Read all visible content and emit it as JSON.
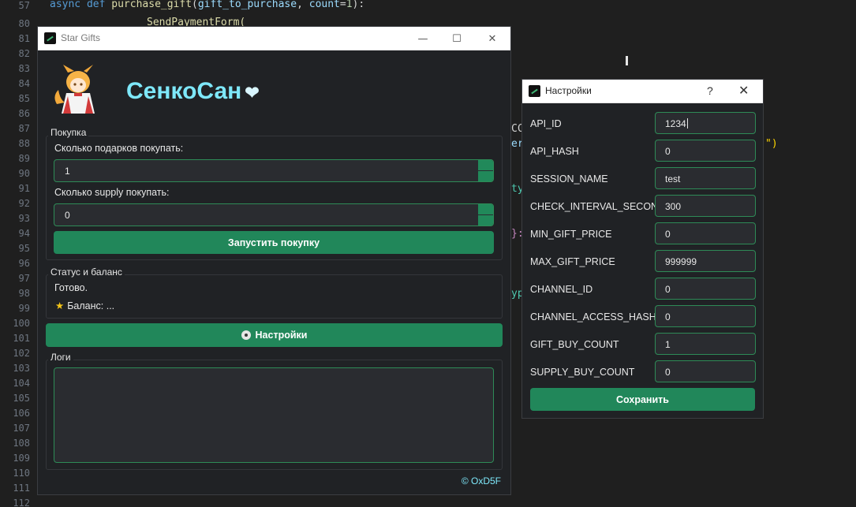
{
  "editor": {
    "line_numbers": [
      "57",
      "80",
      "81",
      "82",
      "83",
      "84",
      "85",
      "86",
      "87",
      "88",
      "89",
      "90",
      "91",
      "92",
      "93",
      "94",
      "95",
      "96",
      "97",
      "98",
      "99",
      "100",
      "101",
      "102",
      "103",
      "104",
      "105",
      "106",
      "107",
      "108",
      "109",
      "110",
      "111",
      "112"
    ],
    "top_line": {
      "kw": "async def ",
      "fn": "purchase_gift",
      "paren_open": "(",
      "p1": "gift_to_purchase",
      "sep": ", ",
      "p2": "count",
      "eq": "=",
      "num": "1",
      "end": "):"
    },
    "line80": "SendPaymentForm(",
    "fragments": [
      {
        "text": "CC",
        "color": "#d4d4d4"
      },
      {
        "text": "er",
        "color": "#9cdcfe"
      },
      {
        "text": "ty",
        "color": "#4ec9b0"
      },
      {
        "text": "}:",
        "color": "#c586c0"
      },
      {
        "text": "yp",
        "color": "#4ec9b0"
      },
      {
        "text": "\")",
        "color": "#ffd700"
      }
    ]
  },
  "main_window": {
    "title": "Star Gifts",
    "controls": {
      "minimize": "—",
      "maximize": "☐",
      "close": "✕"
    },
    "brand_name": "СенкоСан",
    "brand_heart": "❤",
    "purchase_group": {
      "title": "Покупка",
      "gifts_label": "Сколько подарков покупать:",
      "gifts_value": "1",
      "supply_label": "Сколько supply покупать:",
      "supply_value": "0",
      "start_button": "Запустить покупку"
    },
    "status_group": {
      "title": "Статус и баланс",
      "status_text": "Готово.",
      "balance_icon": "★",
      "balance_text": "Баланс: ..."
    },
    "settings_button": "Настройки",
    "logs_group": {
      "title": "Логи"
    },
    "copyright": "© OxD5F"
  },
  "settings_dialog": {
    "title": "Настройки",
    "help": "?",
    "close": "✕",
    "fields": [
      {
        "label": "API_ID",
        "value": "1234"
      },
      {
        "label": "API_HASH",
        "value": "0"
      },
      {
        "label": "SESSION_NAME",
        "value": "test"
      },
      {
        "label": "CHECK_INTERVAL_SECONDS",
        "value": "300"
      },
      {
        "label": "MIN_GIFT_PRICE",
        "value": "0"
      },
      {
        "label": "MAX_GIFT_PRICE",
        "value": "999999"
      },
      {
        "label": "CHANNEL_ID",
        "value": "0"
      },
      {
        "label": "CHANNEL_ACCESS_HASH",
        "value": "0"
      },
      {
        "label": "GIFT_BUY_COUNT",
        "value": "1"
      },
      {
        "label": "SUPPLY_BUY_COUNT",
        "value": "0"
      }
    ],
    "save_button": "Сохранить"
  },
  "colors": {
    "accent_green": "#21875a",
    "border_green": "#2e8b57",
    "brand_cyan": "#7ee8fa",
    "balance_star": "#f5c518"
  }
}
